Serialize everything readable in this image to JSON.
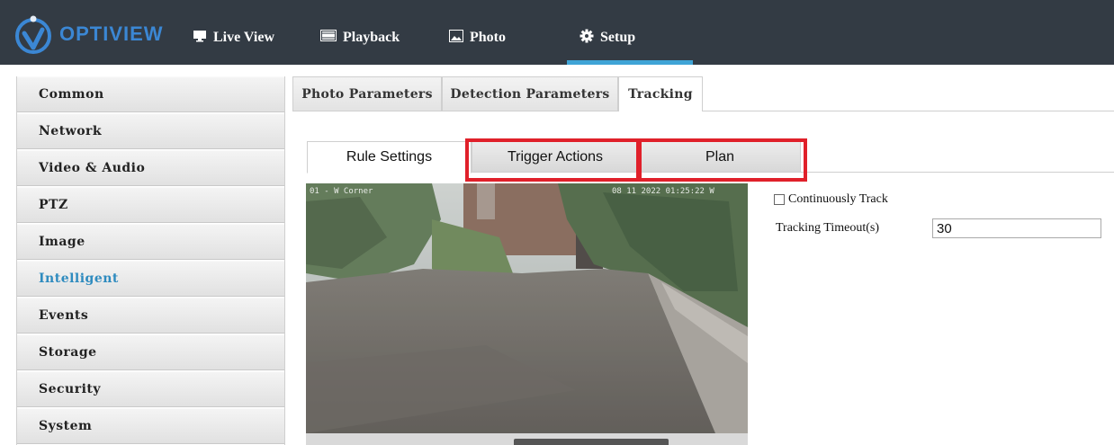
{
  "brand": {
    "name": "OPTIVIEW",
    "accent": "#3b87d4"
  },
  "nav": {
    "items": [
      {
        "label": "Live View",
        "icon": "monitor-icon"
      },
      {
        "label": "Playback",
        "icon": "film-icon"
      },
      {
        "label": "Photo",
        "icon": "photo-icon"
      },
      {
        "label": "Setup",
        "icon": "gear-icon"
      }
    ],
    "active": "Setup",
    "active_color": "#3fa4d6"
  },
  "sidebar": {
    "items": [
      {
        "label": "Common"
      },
      {
        "label": "Network"
      },
      {
        "label": "Video & Audio"
      },
      {
        "label": "PTZ"
      },
      {
        "label": "Image"
      },
      {
        "label": "Intelligent"
      },
      {
        "label": "Events"
      },
      {
        "label": "Storage"
      },
      {
        "label": "Security"
      },
      {
        "label": "System"
      }
    ],
    "active": "Intelligent",
    "active_color": "#2e8bbf"
  },
  "subtabs": {
    "items": [
      {
        "label": "Photo Parameters"
      },
      {
        "label": "Detection Parameters"
      },
      {
        "label": "Tracking"
      }
    ],
    "active": "Tracking"
  },
  "tracking_tabs": {
    "items": [
      {
        "label": "Rule Settings"
      },
      {
        "label": "Trigger Actions"
      },
      {
        "label": "Plan"
      }
    ],
    "active": "Rule Settings",
    "highlight_color": "#e0202a"
  },
  "video": {
    "osd_left": "01 - W Corner",
    "osd_right": "08 11 2022 01:25:22 W"
  },
  "form": {
    "continuously_track": {
      "label": "Continuously Track",
      "checked": false
    },
    "tracking_timeout": {
      "label": "Tracking Timeout(s)",
      "value": "30"
    }
  }
}
